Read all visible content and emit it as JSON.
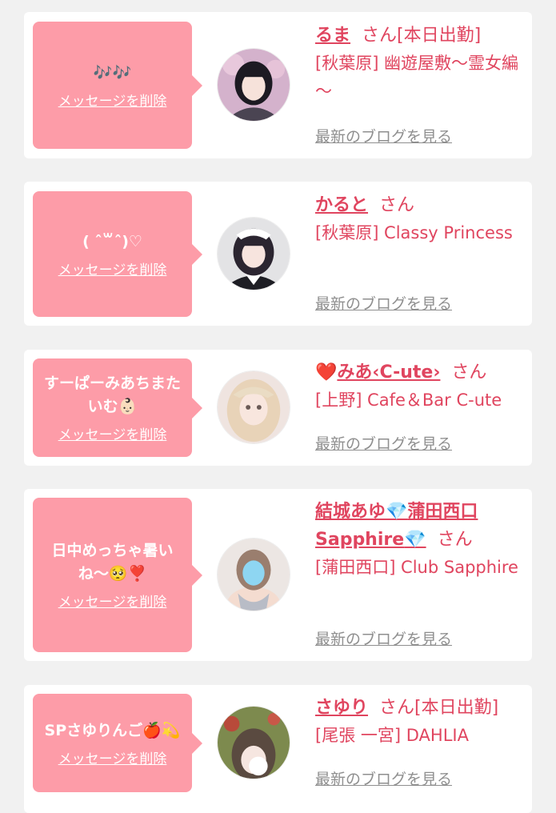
{
  "cards": [
    {
      "message": "🎶🎶",
      "delete_label": "メッセージを削除",
      "name": "るま",
      "honorific": "さん",
      "status": "[本日出勤]",
      "shop": "[秋葉原] 幽遊屋敷～霊女編～",
      "blog_label": "最新のブログを見る",
      "avatar": "avatar-dark-hair"
    },
    {
      "message": "( ˆ꒳ˆ)♡",
      "delete_label": "メッセージを削除",
      "name": "かると",
      "honorific": "さん",
      "status": "",
      "shop": "[秋葉原] Classy Princess",
      "blog_label": "最新のブログを見る",
      "avatar": "avatar-maid-outfit"
    },
    {
      "message": "すーぱーみあちまたいむ👶🏻",
      "delete_label": "メッセージを削除",
      "name_prefix": "❤️",
      "name": "みあ‹C-ute›",
      "honorific": "さん",
      "status": "",
      "shop": "[上野] Cafe＆Bar C-ute",
      "blog_label": "最新のブログを見る",
      "avatar": "avatar-blonde-hair"
    },
    {
      "message": "日中めっちゃ暑いね〜🥺❣️",
      "delete_label": "メッセージを削除",
      "name_part1": "結城あゆ",
      "name_gem": "💎",
      "name_part2": "蒲田西口Sapphire",
      "name_gem2": "💎",
      "honorific": "さん",
      "status": "",
      "shop": "[蒲田西口] Club Sapphire",
      "blog_label": "最新のブログを見る",
      "avatar": "avatar-silver-outfit"
    },
    {
      "message": "SPさゆりんご🍎💫",
      "delete_label": "メッセージを削除",
      "name": "さゆり",
      "honorific": "さん",
      "status": "[本日出勤]",
      "shop": "[尾張 一宮] DAHLIA",
      "blog_label": "最新のブログを見る",
      "avatar": "avatar-garden-photo"
    }
  ],
  "colors": {
    "bubble": "#fd9ca8",
    "accent": "#e0455f",
    "link_gray": "#8f8f8f",
    "page_bg": "#f1f1f1"
  }
}
